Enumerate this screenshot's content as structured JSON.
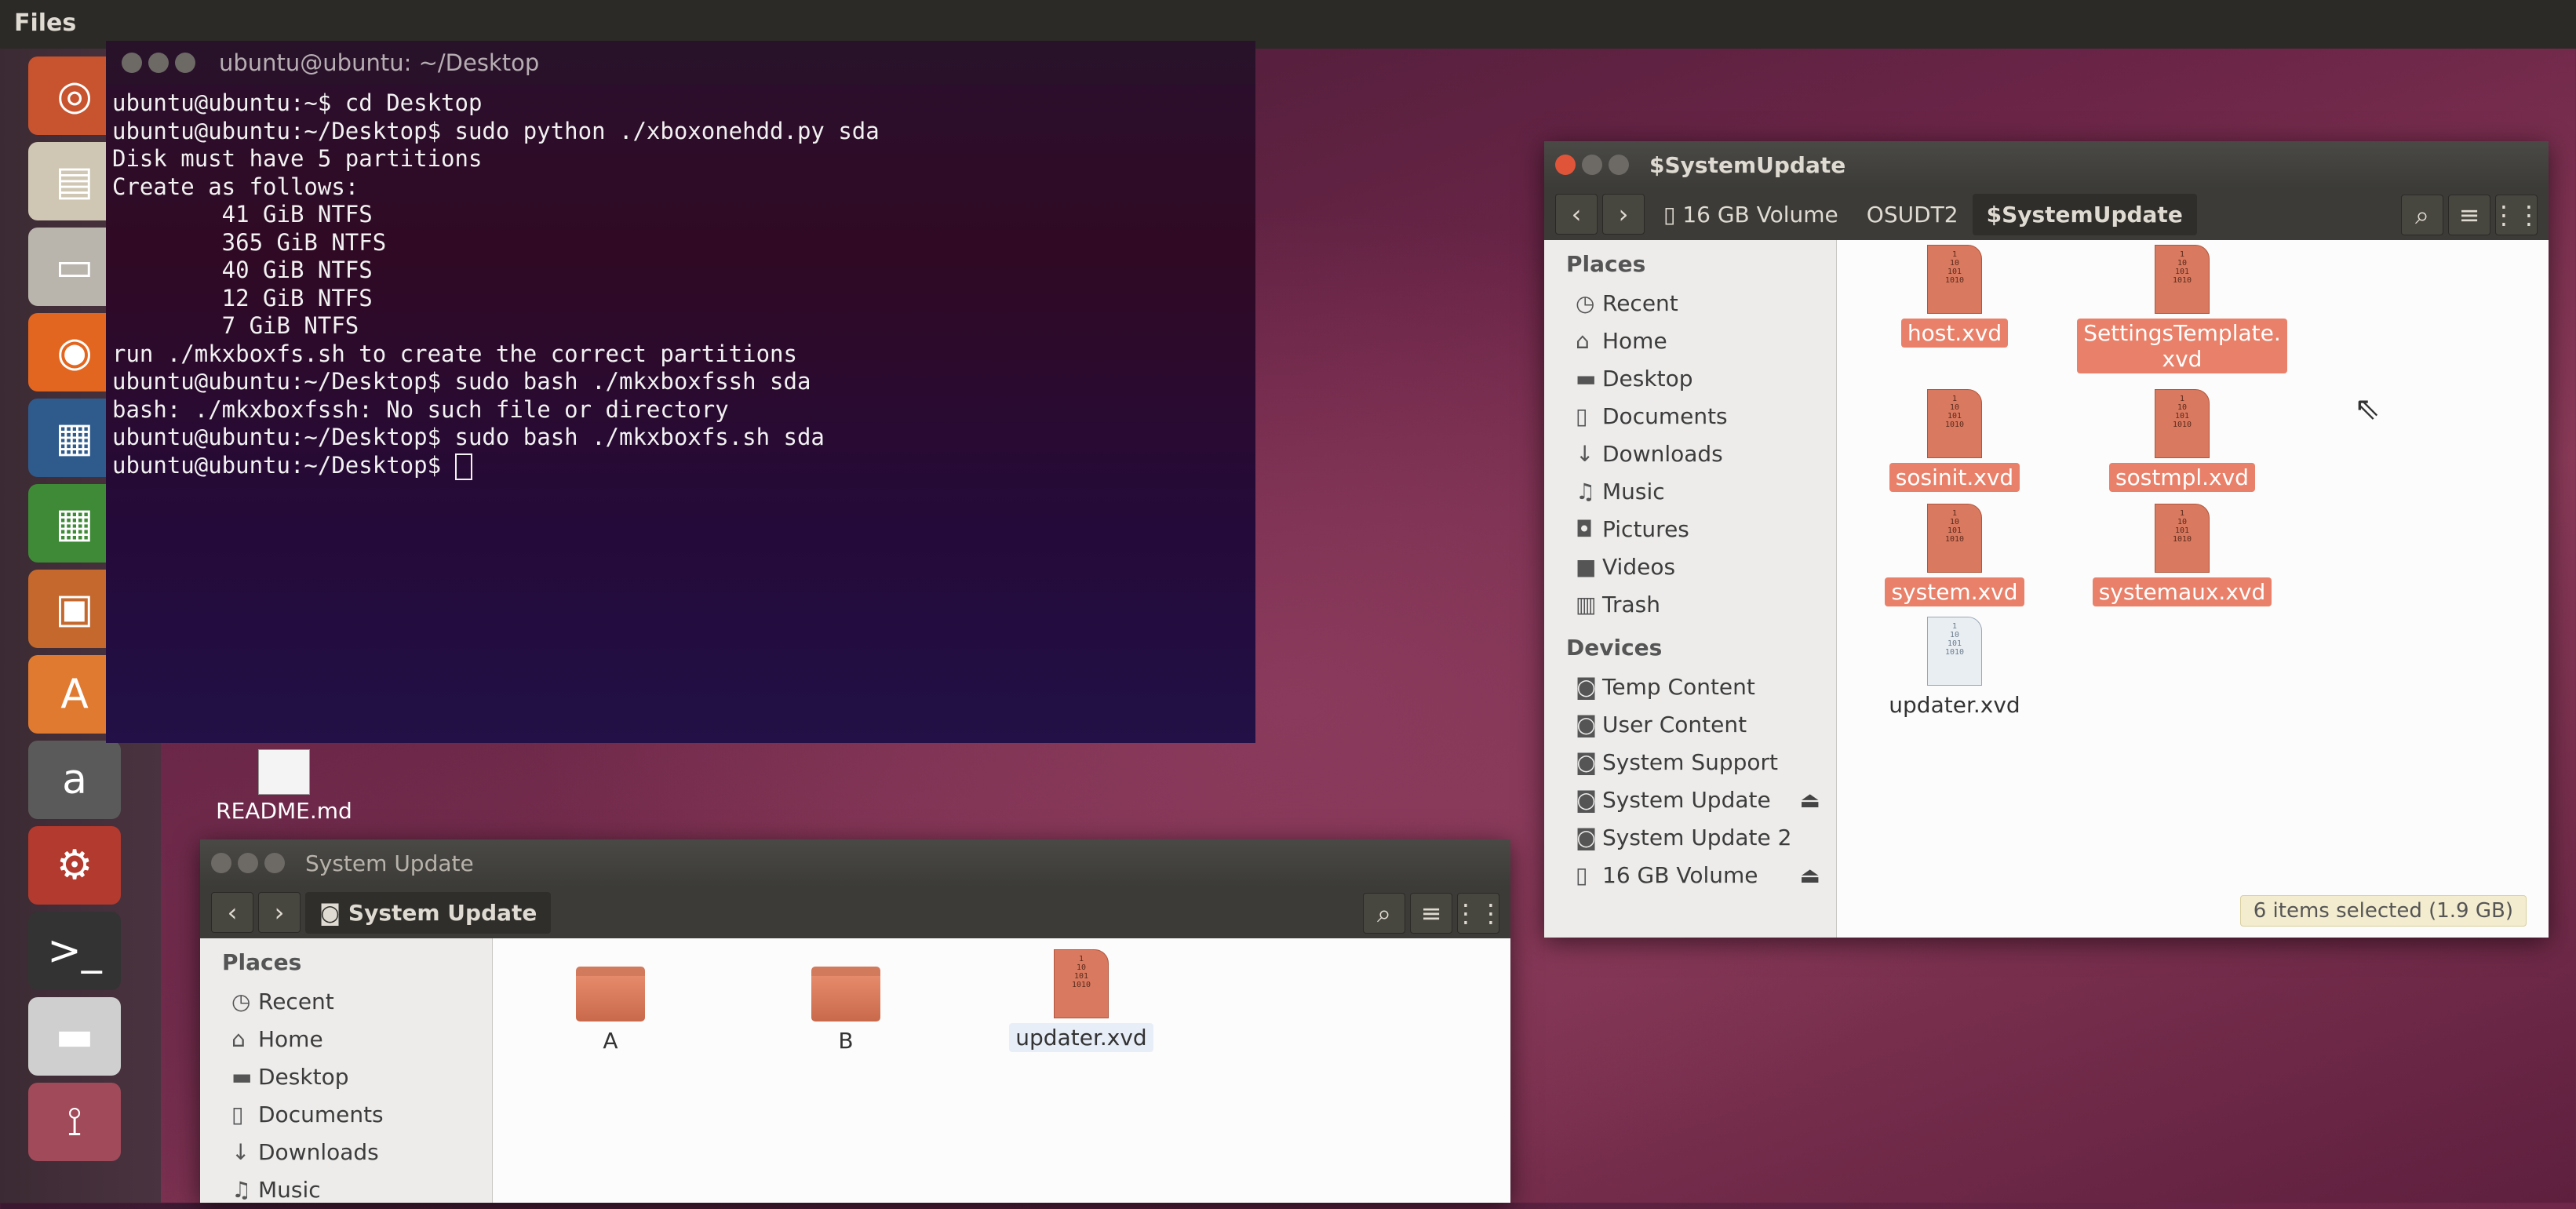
{
  "top_panel": {
    "app_name": "Files"
  },
  "launcher": {
    "items": [
      {
        "name": "ubuntu-dash",
        "icon": "ubuntu-logo-icon",
        "glyph": "◎",
        "bg": "#c8532f"
      },
      {
        "name": "system-settings",
        "icon": "system-monitor-icon",
        "glyph": "▤",
        "bg": "#cfc6b3"
      },
      {
        "name": "files",
        "icon": "file-cabinet-icon",
        "glyph": "▭",
        "bg": "#b9b5ad",
        "active": true
      },
      {
        "name": "firefox",
        "icon": "firefox-icon",
        "glyph": "◉",
        "bg": "#e2661f"
      },
      {
        "name": "writer",
        "icon": "libreoffice-writer-icon",
        "glyph": "▦",
        "bg": "#2f5b8c"
      },
      {
        "name": "calc",
        "icon": "libreoffice-calc-icon",
        "glyph": "▦",
        "bg": "#3e8a37"
      },
      {
        "name": "impress",
        "icon": "libreoffice-impress-icon",
        "glyph": "▣",
        "bg": "#c4682d"
      },
      {
        "name": "software-center",
        "icon": "software-center-icon",
        "glyph": "A",
        "bg": "#e07a30"
      },
      {
        "name": "amazon",
        "icon": "amazon-icon",
        "glyph": "a",
        "bg": "#5a5a5a"
      },
      {
        "name": "system-tools",
        "icon": "wrench-gear-icon",
        "glyph": "⚙",
        "bg": "#b23a2e"
      },
      {
        "name": "terminal",
        "icon": "terminal-icon",
        "glyph": ">_",
        "bg": "#333333"
      },
      {
        "name": "drive",
        "icon": "drive-icon",
        "glyph": "▬",
        "bg": "#cfcfcf"
      },
      {
        "name": "usb",
        "icon": "usb-icon",
        "glyph": "⟟",
        "bg": "#a04a5a"
      }
    ]
  },
  "terminal": {
    "title": "ubuntu@ubuntu: ~/Desktop",
    "lines": [
      "ubuntu@ubuntu:~$ cd Desktop",
      "ubuntu@ubuntu:~/Desktop$ sudo python ./xboxonehdd.py sda",
      "Disk must have 5 partitions",
      "Create as follows:",
      "        41 GiB NTFS",
      "        365 GiB NTFS",
      "        40 GiB NTFS",
      "        12 GiB NTFS",
      "        7 GiB NTFS",
      "run ./mkxboxfs.sh to create the correct partitions",
      "ubuntu@ubuntu:~/Desktop$ sudo bash ./mkxboxfssh sda",
      "bash: ./mkxboxfssh: No such file or directory",
      "ubuntu@ubuntu:~/Desktop$ sudo bash ./mkxboxfs.sh sda",
      "ubuntu@ubuntu:~/Desktop$ "
    ]
  },
  "desktop": {
    "readme_label": "README.md"
  },
  "window_right": {
    "title": "$SystemUpdate",
    "breadcrumbs": [
      "16 GB Volume",
      "OSUDT2",
      "$SystemUpdate"
    ],
    "places_header": "Places",
    "places": [
      {
        "label": "Recent",
        "icon": "clock-icon",
        "glyph": "◷"
      },
      {
        "label": "Home",
        "icon": "home-icon",
        "glyph": "⌂"
      },
      {
        "label": "Desktop",
        "icon": "desktop-folder-icon",
        "glyph": "▬"
      },
      {
        "label": "Documents",
        "icon": "document-icon",
        "glyph": "▯"
      },
      {
        "label": "Downloads",
        "icon": "download-icon",
        "glyph": "↓"
      },
      {
        "label": "Music",
        "icon": "music-icon",
        "glyph": "♫"
      },
      {
        "label": "Pictures",
        "icon": "camera-icon",
        "glyph": "◘"
      },
      {
        "label": "Videos",
        "icon": "video-icon",
        "glyph": "■"
      },
      {
        "label": "Trash",
        "icon": "trash-icon",
        "glyph": "▥"
      }
    ],
    "devices_header": "Devices",
    "devices": [
      {
        "label": "Temp Content",
        "icon": "drive-icon",
        "glyph": "◙",
        "eject": false
      },
      {
        "label": "User Content",
        "icon": "drive-icon",
        "glyph": "◙",
        "eject": false
      },
      {
        "label": "System Support",
        "icon": "drive-icon",
        "glyph": "◙",
        "eject": false
      },
      {
        "label": "System Update",
        "icon": "drive-icon",
        "glyph": "◙",
        "eject": true
      },
      {
        "label": "System Update 2",
        "icon": "drive-icon",
        "glyph": "◙",
        "eject": false
      },
      {
        "label": "16 GB Volume",
        "icon": "usb-drive-icon",
        "glyph": "▯",
        "eject": true
      }
    ],
    "files": [
      {
        "name": "host.xvd",
        "selected": true
      },
      {
        "name": "SettingsTemplate.\nxvd",
        "selected": true
      },
      {
        "name": "sosinit.xvd",
        "selected": true
      },
      {
        "name": "sostmpl.xvd",
        "selected": true
      },
      {
        "name": "system.xvd",
        "selected": true
      },
      {
        "name": "systemaux.xvd",
        "selected": true
      },
      {
        "name": "updater.xvd",
        "selected": false
      }
    ],
    "status": "6 items selected (1.9 GB)"
  },
  "window_left": {
    "title": "System Update",
    "breadcrumb": "System Update",
    "places_header": "Places",
    "places": [
      {
        "label": "Recent",
        "icon": "clock-icon",
        "glyph": "◷"
      },
      {
        "label": "Home",
        "icon": "home-icon",
        "glyph": "⌂"
      },
      {
        "label": "Desktop",
        "icon": "desktop-folder-icon",
        "glyph": "▬"
      },
      {
        "label": "Documents",
        "icon": "document-icon",
        "glyph": "▯"
      },
      {
        "label": "Downloads",
        "icon": "download-icon",
        "glyph": "↓"
      },
      {
        "label": "Music",
        "icon": "music-icon",
        "glyph": "♫"
      }
    ],
    "items": [
      {
        "name": "A",
        "type": "folder"
      },
      {
        "name": "B",
        "type": "folder"
      },
      {
        "name": "updater.xvd",
        "type": "file"
      }
    ]
  },
  "file_glyph": "1\n10\n101\n1010"
}
